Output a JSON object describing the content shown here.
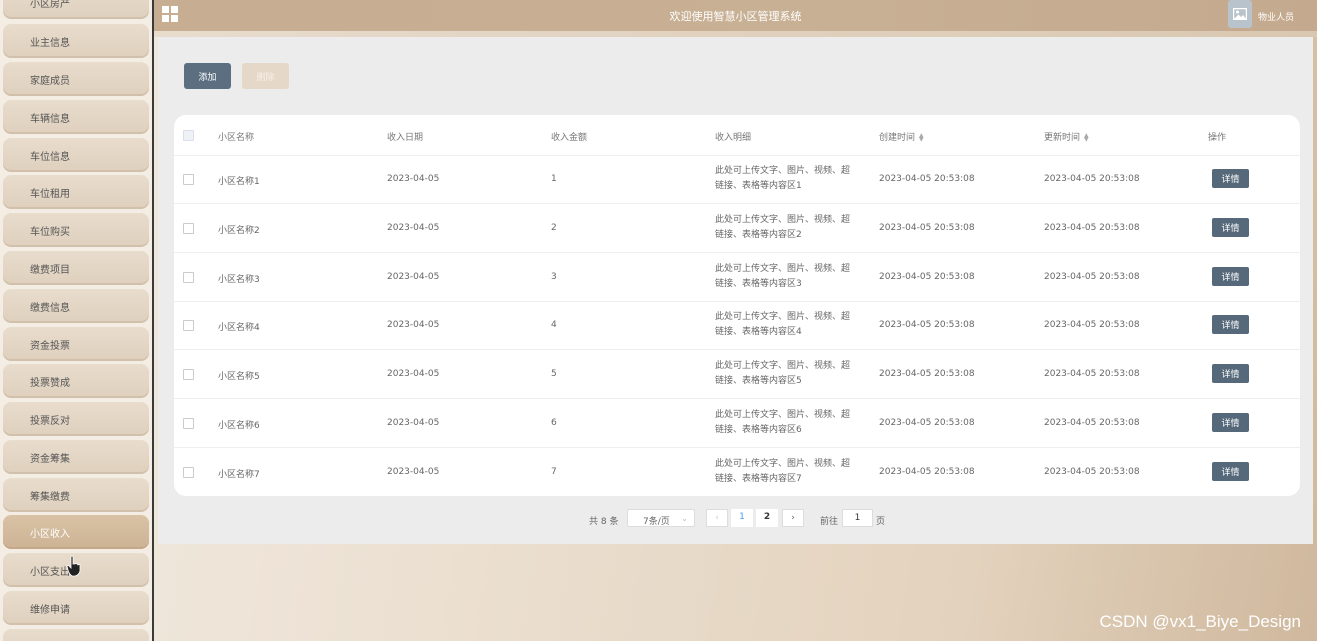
{
  "sidebar": {
    "items": [
      {
        "label": "小区房产",
        "active": false
      },
      {
        "label": "业主信息",
        "active": false
      },
      {
        "label": "家庭成员",
        "active": false
      },
      {
        "label": "车辆信息",
        "active": false
      },
      {
        "label": "车位信息",
        "active": false
      },
      {
        "label": "车位租用",
        "active": false
      },
      {
        "label": "车位购买",
        "active": false
      },
      {
        "label": "缴费项目",
        "active": false
      },
      {
        "label": "缴费信息",
        "active": false
      },
      {
        "label": "资金投票",
        "active": false
      },
      {
        "label": "投票赞成",
        "active": false
      },
      {
        "label": "投票反对",
        "active": false
      },
      {
        "label": "资金筹集",
        "active": false
      },
      {
        "label": "筹集缴费",
        "active": false
      },
      {
        "label": "小区收入",
        "active": true
      },
      {
        "label": "小区支出",
        "active": false
      },
      {
        "label": "维修申请",
        "active": false
      }
    ]
  },
  "header": {
    "title": "欢迎使用智慧小区管理系统",
    "user": "物业人员"
  },
  "toolbar": {
    "add_label": "添加",
    "delete_label": "删除"
  },
  "table": {
    "columns": [
      "小区名称",
      "收入日期",
      "收入金额",
      "收入明细",
      "创建时间",
      "更新时间",
      "操作"
    ],
    "detail_button": "详情",
    "rows": [
      {
        "name": "小区名称1",
        "date": "2023-04-05",
        "amount": "1",
        "detail_l1": "此处可上传文字、图片、视频、超",
        "detail_l2": "链接、表格等内容区1",
        "created": "2023-04-05 20:53:08",
        "updated": "2023-04-05 20:53:08"
      },
      {
        "name": "小区名称2",
        "date": "2023-04-05",
        "amount": "2",
        "detail_l1": "此处可上传文字、图片、视频、超",
        "detail_l2": "链接、表格等内容区2",
        "created": "2023-04-05 20:53:08",
        "updated": "2023-04-05 20:53:08"
      },
      {
        "name": "小区名称3",
        "date": "2023-04-05",
        "amount": "3",
        "detail_l1": "此处可上传文字、图片、视频、超",
        "detail_l2": "链接、表格等内容区3",
        "created": "2023-04-05 20:53:08",
        "updated": "2023-04-05 20:53:08"
      },
      {
        "name": "小区名称4",
        "date": "2023-04-05",
        "amount": "4",
        "detail_l1": "此处可上传文字、图片、视频、超",
        "detail_l2": "链接、表格等内容区4",
        "created": "2023-04-05 20:53:08",
        "updated": "2023-04-05 20:53:08"
      },
      {
        "name": "小区名称5",
        "date": "2023-04-05",
        "amount": "5",
        "detail_l1": "此处可上传文字、图片、视频、超",
        "detail_l2": "链接、表格等内容区5",
        "created": "2023-04-05 20:53:08",
        "updated": "2023-04-05 20:53:08"
      },
      {
        "name": "小区名称6",
        "date": "2023-04-05",
        "amount": "6",
        "detail_l1": "此处可上传文字、图片、视频、超",
        "detail_l2": "链接、表格等内容区6",
        "created": "2023-04-05 20:53:08",
        "updated": "2023-04-05 20:53:08"
      },
      {
        "name": "小区名称7",
        "date": "2023-04-05",
        "amount": "7",
        "detail_l1": "此处可上传文字、图片、视频、超",
        "detail_l2": "链接、表格等内容区7",
        "created": "2023-04-05 20:53:08",
        "updated": "2023-04-05 20:53:08"
      }
    ]
  },
  "pagination": {
    "total": "共 8 条",
    "page_size": "7条/页",
    "pages": [
      "1",
      "2"
    ],
    "goto_label": "前往",
    "goto_value": "1",
    "page_suffix": "页"
  },
  "watermark": "CSDN @vx1_Biye_Design",
  "colors": {
    "header": "#c7ad92",
    "primary_button": "#5c6f80",
    "detail_button": "#55697a",
    "active_page": "#409eff"
  }
}
